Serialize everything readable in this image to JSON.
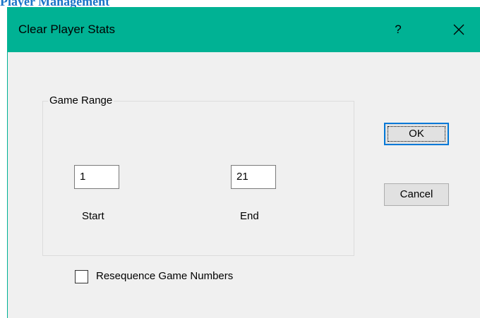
{
  "page": {
    "heading_fragment": "Player Management"
  },
  "dialog": {
    "title": "Clear Player Stats",
    "help_glyph": "?",
    "close_icon": "close-icon",
    "accent_color": "#00b294",
    "group": {
      "label": "Game Range",
      "start": {
        "value": "1",
        "label": "Start"
      },
      "end": {
        "value": "21",
        "label": "End"
      }
    },
    "buttons": {
      "ok": "OK",
      "cancel": "Cancel"
    },
    "resequence": {
      "label": "Resequence Game Numbers",
      "checked": false
    }
  }
}
